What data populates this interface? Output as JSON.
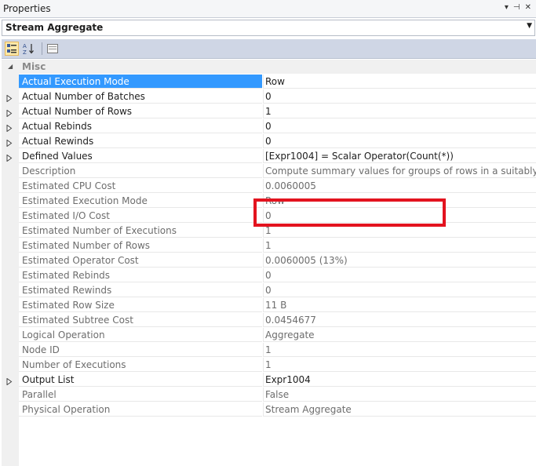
{
  "panel": {
    "title": "Properties",
    "controls": [
      "▾",
      "⊣",
      "✕"
    ]
  },
  "object": {
    "name": "Stream Aggregate"
  },
  "category": {
    "label": "Misc"
  },
  "rows": [
    {
      "name": "Actual Execution Mode",
      "value": "Row",
      "expandable": false,
      "readonly": false
    },
    {
      "name": "Actual Number of Batches",
      "value": "0",
      "expandable": true,
      "readonly": false
    },
    {
      "name": "Actual Number of Rows",
      "value": "1",
      "expandable": true,
      "readonly": false
    },
    {
      "name": "Actual Rebinds",
      "value": "0",
      "expandable": true,
      "readonly": false
    },
    {
      "name": "Actual Rewinds",
      "value": "0",
      "expandable": true,
      "readonly": false
    },
    {
      "name": "Defined Values",
      "value": "[Expr1004] = Scalar Operator(Count(*))",
      "expandable": true,
      "readonly": false
    },
    {
      "name": "Description",
      "value": "Compute summary values for groups of rows in a suitably sorted stream.",
      "expandable": false,
      "readonly": true
    },
    {
      "name": "Estimated CPU Cost",
      "value": "0.0060005",
      "expandable": false,
      "readonly": true
    },
    {
      "name": "Estimated Execution Mode",
      "value": "Row",
      "expandable": false,
      "readonly": true
    },
    {
      "name": "Estimated I/O Cost",
      "value": "0",
      "expandable": false,
      "readonly": true
    },
    {
      "name": "Estimated Number of Executions",
      "value": "1",
      "expandable": false,
      "readonly": true
    },
    {
      "name": "Estimated Number of Rows",
      "value": "1",
      "expandable": false,
      "readonly": true
    },
    {
      "name": "Estimated Operator Cost",
      "value": "0.0060005 (13%)",
      "expandable": false,
      "readonly": true
    },
    {
      "name": "Estimated Rebinds",
      "value": "0",
      "expandable": false,
      "readonly": true
    },
    {
      "name": "Estimated Rewinds",
      "value": "0",
      "expandable": false,
      "readonly": true
    },
    {
      "name": "Estimated Row Size",
      "value": "11 B",
      "expandable": false,
      "readonly": true
    },
    {
      "name": "Estimated Subtree Cost",
      "value": "0.0454677",
      "expandable": false,
      "readonly": true
    },
    {
      "name": "Logical Operation",
      "value": "Aggregate",
      "expandable": false,
      "readonly": true
    },
    {
      "name": "Node ID",
      "value": "1",
      "expandable": false,
      "readonly": true
    },
    {
      "name": "Number of Executions",
      "value": "1",
      "expandable": false,
      "readonly": true
    },
    {
      "name": "Output List",
      "value": "Expr1004",
      "expandable": true,
      "readonly": false
    },
    {
      "name": "Parallel",
      "value": "False",
      "expandable": false,
      "readonly": true
    },
    {
      "name": "Physical Operation",
      "value": "Stream Aggregate",
      "expandable": false,
      "readonly": true
    }
  ],
  "colors": {
    "selection": "#3399ff",
    "highlight_box": "#e3131f",
    "toolbar": "#cfd6e5"
  }
}
